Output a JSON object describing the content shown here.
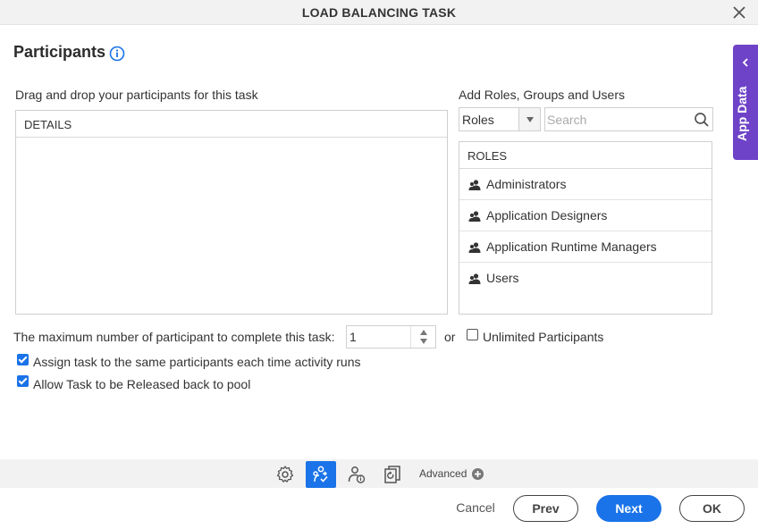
{
  "dialog": {
    "title": "LOAD BALANCING TASK"
  },
  "section": {
    "title": "Participants"
  },
  "left_panel": {
    "label": "Drag and drop your participants for this task",
    "header": "DETAILS"
  },
  "right_panel": {
    "label": "Add Roles, Groups and Users",
    "type_select_value": "Roles",
    "search_placeholder": "Search",
    "list_header": "ROLES",
    "items": [
      {
        "label": "Administrators"
      },
      {
        "label": "Application Designers"
      },
      {
        "label": "Application Runtime Managers"
      },
      {
        "label": "Users"
      }
    ]
  },
  "side_tab": {
    "label": "App Data"
  },
  "options": {
    "max_label": "The maximum number of participant to complete this task:",
    "max_value": "1",
    "or_text": "or",
    "unlimited_label": "Unlimited Participants",
    "unlimited_checked": false,
    "same_participants_label": "Assign task to the same participants each time activity runs",
    "same_participants_checked": true,
    "release_label": "Allow Task to be Released back to pool",
    "release_checked": true
  },
  "toolbar": {
    "advanced_label": "Advanced",
    "icons": [
      "gear-icon",
      "participants-icon",
      "user-info-icon",
      "task-document-icon"
    ],
    "active_icon": "participants-icon"
  },
  "footer": {
    "cancel": "Cancel",
    "prev": "Prev",
    "next": "Next",
    "ok": "OK"
  },
  "colors": {
    "primary": "#1a73e8",
    "app_data_tab": "#6f43c8"
  }
}
